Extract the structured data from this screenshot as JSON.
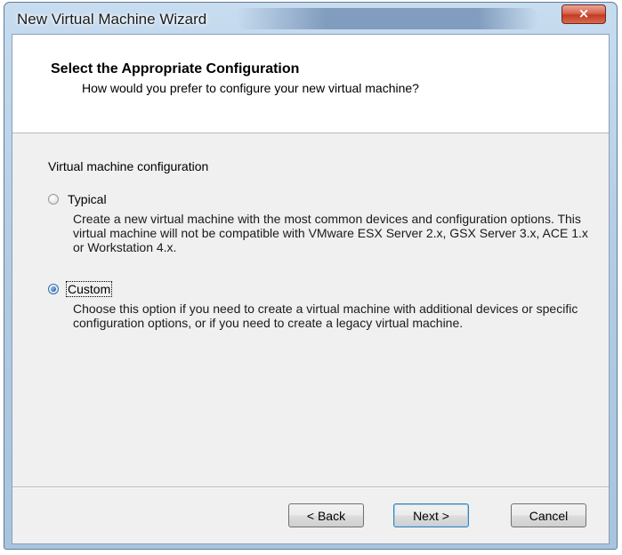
{
  "window": {
    "title": "New Virtual Machine Wizard",
    "close_glyph": "×"
  },
  "header": {
    "title": "Select the Appropriate Configuration",
    "subtitle": "How would you prefer to configure your new virtual machine?"
  },
  "config": {
    "section_label": "Virtual machine configuration",
    "options": [
      {
        "label": "Typical",
        "checked": false,
        "description": "Create a new virtual machine with the most common devices and configuration options. This virtual machine will not be compatible with VMware ESX Server 2.x, GSX Server 3.x, ACE 1.x or Workstation 4.x."
      },
      {
        "label": "Custom",
        "checked": true,
        "description": "Choose this option if you need to create a virtual machine with additional devices or specific configuration options, or if you need to create a legacy virtual machine."
      }
    ]
  },
  "buttons": {
    "back": "< Back",
    "next": "Next >",
    "cancel": "Cancel"
  }
}
